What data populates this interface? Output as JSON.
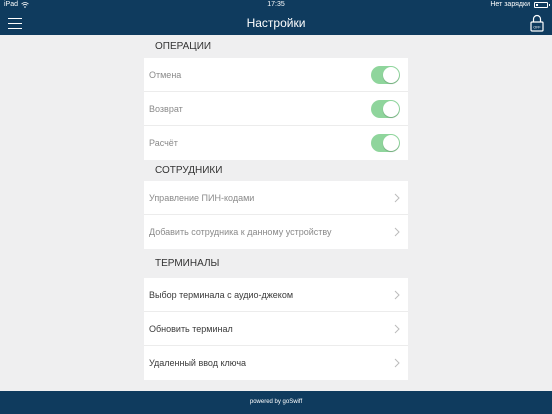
{
  "statusbar": {
    "device": "iPad",
    "wifi_icon": "wifi-icon",
    "time": "17:35",
    "battery_text": "Нет зарядки",
    "battery_level": 0.2
  },
  "navbar": {
    "title": "Настройки",
    "menu_icon": "hamburger-menu-icon",
    "lock_icon": "lock-icon",
    "lock_label": "OFF"
  },
  "sections": [
    {
      "title": "ОПЕРАЦИИ",
      "rows": [
        {
          "label": "Отмена",
          "type": "toggle",
          "on": true
        },
        {
          "label": "Возврат",
          "type": "toggle",
          "on": true
        },
        {
          "label": "Расчёт",
          "type": "toggle",
          "on": true
        }
      ]
    },
    {
      "title": "СОТРУДНИКИ",
      "rows": [
        {
          "label": "Управление ПИН-кодами",
          "type": "nav"
        },
        {
          "label": "Добавить сотрудника к данному устройству",
          "type": "nav"
        }
      ]
    },
    {
      "title": "ТЕРМИНАЛЫ",
      "rows": [
        {
          "label": "Выбор терминала с аудио-джеком",
          "type": "nav"
        },
        {
          "label": "Обновить терминал",
          "type": "nav"
        },
        {
          "label": "Удаленный ввод ключа",
          "type": "nav"
        }
      ]
    }
  ],
  "footer": {
    "text": "powered by goSwiff"
  },
  "colors": {
    "brand": "#0f3b5e",
    "toggle_on": "#8fd59c",
    "background": "#efeff0"
  }
}
